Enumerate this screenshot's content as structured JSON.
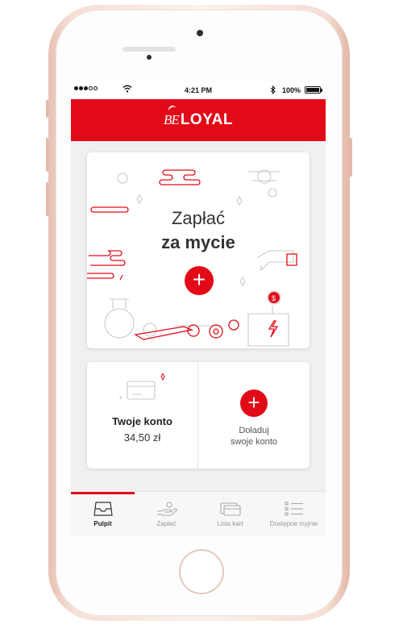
{
  "status_bar": {
    "time": "4:21 PM",
    "battery": "100%"
  },
  "header": {
    "logo_be": "BE",
    "logo_loyal": "LOYAL"
  },
  "pay_card": {
    "title": "Zapłać",
    "subtitle": "za mycie",
    "action": "+"
  },
  "account_card": {
    "title": "Twoje konto",
    "balance": "34,50 zł"
  },
  "topup_card": {
    "action": "+",
    "label_line1": "Doładuj",
    "label_line2": "swoje konto"
  },
  "tabs": [
    {
      "label": "Pulpit",
      "icon": "dashboard-icon",
      "active": true
    },
    {
      "label": "Zapłać",
      "icon": "pay-hand-icon",
      "active": false
    },
    {
      "label": "Lista kart",
      "icon": "cards-icon",
      "active": false
    },
    {
      "label": "Dostępne myjnie",
      "icon": "list-icon",
      "active": false
    }
  ],
  "colors": {
    "accent": "#e30a18",
    "background": "#f0f0f0",
    "tab_active": "#222222",
    "tab_inactive": "#999999"
  }
}
